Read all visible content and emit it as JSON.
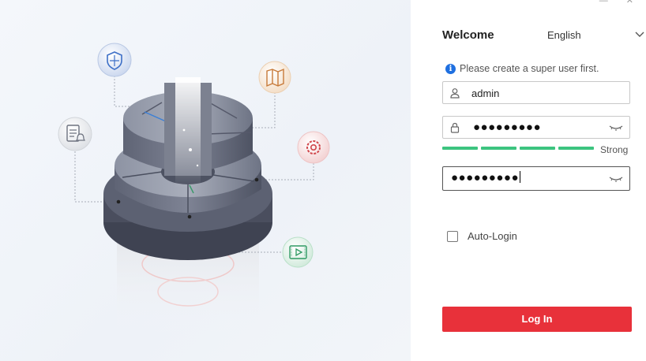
{
  "window": {
    "controls": "— ✕"
  },
  "login": {
    "welcome": "Welcome",
    "language": "English",
    "hint": "Please create a super user first.",
    "username_value": "admin",
    "password_mask": "●●●●●●●●●",
    "confirm_mask": "●●●●●●●●●",
    "strength_label": "Strong",
    "strength_level": 4,
    "strength_max": 4,
    "auto_login_label": "Auto-Login",
    "auto_login_checked": false,
    "login_button": "Log In"
  },
  "illustration": {
    "icons": [
      "shield-icon",
      "map-icon",
      "document-bell-icon",
      "gear-icon",
      "video-icon"
    ]
  },
  "colors": {
    "accent_red": "#e8313a",
    "strength_green": "#3cc47f",
    "info_blue": "#1e6fe0"
  }
}
